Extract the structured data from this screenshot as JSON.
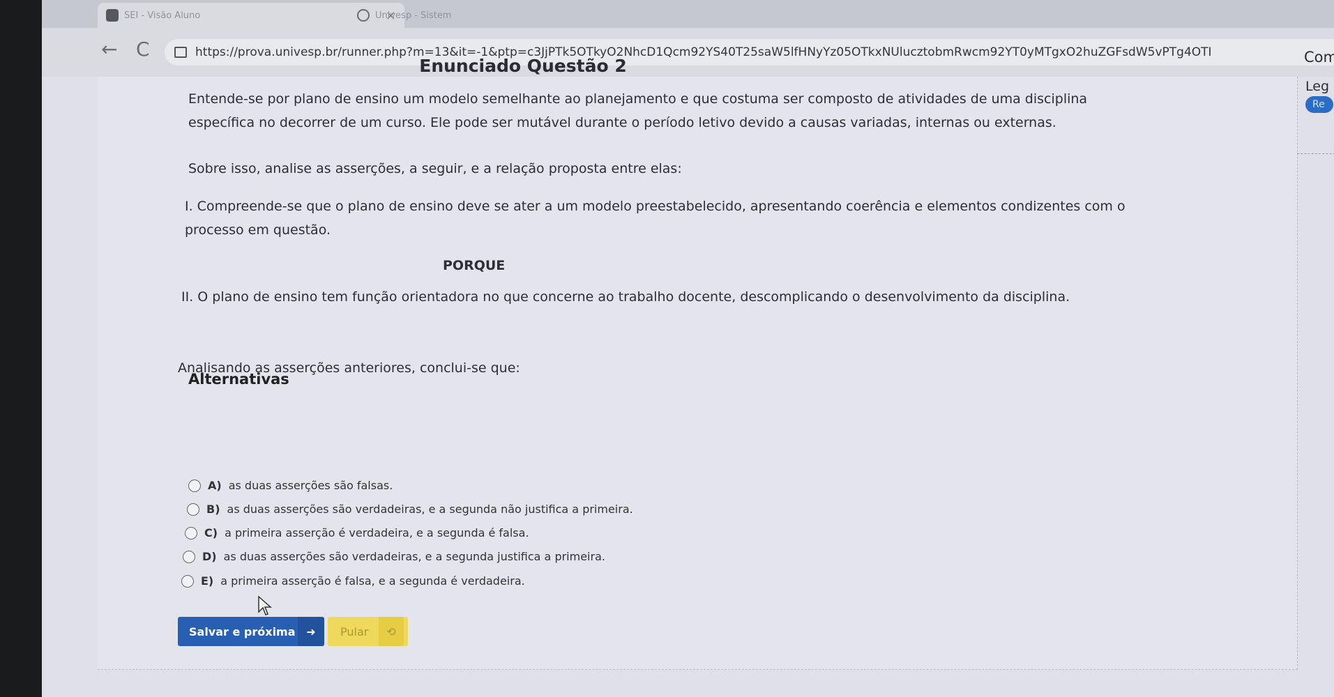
{
  "browser": {
    "tabs": [
      {
        "title": "SEI - Visão Aluno",
        "close": "×"
      },
      {
        "title": "Univesp - Sistem"
      }
    ],
    "url": "https://prova.univesp.br/runner.php?m=13&it=-1&ptp=c3JjPTk5OTkyO2NhcD1Qcm92YS40T25saW5lfHNyYz05OTkxNUlucztobmRwcm92YT0yMTgxO2huZGFsdW5vPTg4OTI",
    "back": "←",
    "reload": "C"
  },
  "question": {
    "title": "Enunciado Questão 2",
    "p1a": "Entende-se por plano de ensino um modelo semelhante ao planejamento e que costuma ser composto de atividades de uma disciplina",
    "p1b": "específica no decorrer de um curso. Ele pode ser mutável durante o período letivo devido a causas variadas, internas ou externas.",
    "p2": "Sobre isso, analise as asserções, a seguir, e a relação proposta entre elas:",
    "p3a": "I. Compreende-se que o plano de ensino deve se ater a um modelo preestabelecido, apresentando coerência e elementos condizentes com o",
    "p3b": "processo em questão.",
    "porque": "PORQUE",
    "p4": "II. O plano de ensino tem função orientadora no que concerne ao trabalho docente, descomplicando o desenvolvimento da disciplina.",
    "p5": "Analisando as asserções anteriores, conclui-se que:"
  },
  "alternatives": {
    "heading": "Alternativas",
    "items": [
      {
        "letter": "A)",
        "text": "as duas asserções são falsas."
      },
      {
        "letter": "B)",
        "text": "as duas asserções são verdadeiras, e a segunda não justifica a primeira."
      },
      {
        "letter": "C)",
        "text": "a primeira asserção é verdadeira, e a segunda é falsa."
      },
      {
        "letter": "D)",
        "text": "as duas asserções são verdadeiras, e a segunda justifica a primeira."
      },
      {
        "letter": "E)",
        "text": "a primeira asserção é falsa, e a segunda é verdadeira."
      }
    ]
  },
  "actions": {
    "save_label": "Salvar e próxima",
    "save_icon": "➜",
    "skip_label": "Pular",
    "skip_icon": "⟲"
  },
  "side_panel": {
    "t1": "Com",
    "t2": "Leg",
    "badge": "Re"
  },
  "colors": {
    "save_button": "#295fb3",
    "skip_button": "#efd95c",
    "badge": "#2b6cc4"
  }
}
